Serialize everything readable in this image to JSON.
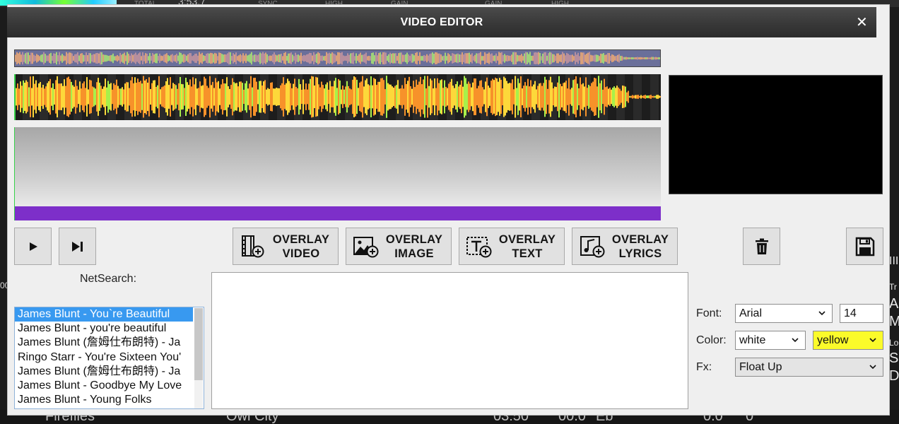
{
  "background": {
    "top_labels": [
      "TOTAL",
      "3:53.7",
      "SYNC",
      "HIGH",
      "GAIN",
      "GAIN",
      "HIGH"
    ],
    "bottom_row": [
      "Fireflies",
      "Owl City",
      "03:50",
      "00.0",
      "Eb",
      "0.0",
      "0"
    ],
    "right_letters": [
      "A",
      "M",
      "Lo",
      "S",
      "D"
    ],
    "right_small": [
      "III",
      "Tr"
    ],
    "left_small": [
      "00"
    ]
  },
  "dialog": {
    "title": "VIDEO EDITOR",
    "close_symbol": "✕"
  },
  "colors": {
    "titlebar": "#3a3a3a",
    "timeline_lane": "#7d2fc9",
    "selected_item": "#3899f0",
    "highlight_select": "#fbfb2a",
    "waveform_primary": "#f7922a",
    "waveform_accent": "#fdd83a",
    "waveform_green": "#a8f04a"
  },
  "transport": {
    "play_icon": "play-icon",
    "next_icon": "skip-next-icon"
  },
  "overlay_buttons": [
    {
      "line1": "OVERLAY",
      "line2": "VIDEO",
      "icon": "film-add-icon"
    },
    {
      "line1": "OVERLAY",
      "line2": "IMAGE",
      "icon": "image-add-icon"
    },
    {
      "line1": "OVERLAY",
      "line2": "TEXT",
      "icon": "text-add-icon"
    },
    {
      "line1": "OVERLAY",
      "line2": "LYRICS",
      "icon": "music-add-icon"
    }
  ],
  "actions": {
    "delete_icon": "trash-icon",
    "save_icon": "floppy-disk-icon"
  },
  "netsearch": {
    "label": "NetSearch:",
    "results": [
      "James Blunt - You`re Beautiful",
      "James Blunt - you're beautiful",
      "James Blunt (詹姆仕布朗特) - Ja",
      "Ringo Starr - You're Sixteen You'",
      "James Blunt (詹姆仕布朗特) - Ja",
      "James Blunt - Goodbye My Love",
      "James Blunt - Young Folks"
    ],
    "selected_index": 0
  },
  "properties": {
    "font_label": "Font:",
    "font_value": "Arial",
    "size_value": "14",
    "color_label": "Color:",
    "color_value": "white",
    "color2_value": "yellow",
    "fx_label": "Fx:",
    "fx_value": "Float Up"
  }
}
